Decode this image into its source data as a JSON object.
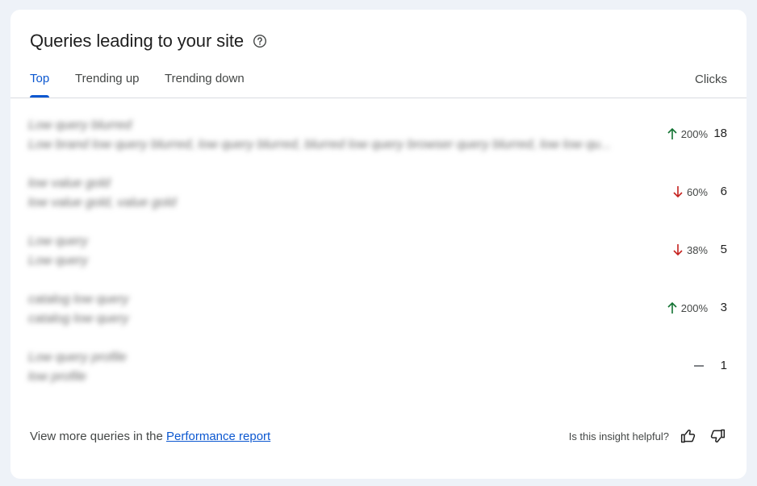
{
  "header": {
    "title": "Queries leading to your site",
    "help_icon": "help-circle-icon"
  },
  "tabs": [
    {
      "label": "Top",
      "active": true
    },
    {
      "label": "Trending up",
      "active": false
    },
    {
      "label": "Trending down",
      "active": false
    }
  ],
  "columns": {
    "clicks": "Clicks"
  },
  "rows": [
    {
      "query": "Low query blurred",
      "subtitle": "Low brand low query blurred, low query blurred, blurred low query browser query blurred, low low qu...",
      "trend": "up",
      "change": "200%",
      "clicks": "18"
    },
    {
      "query": "low value gold",
      "subtitle": "low value gold, value gold",
      "trend": "down",
      "change": "60%",
      "clicks": "6"
    },
    {
      "query": "Low query",
      "subtitle": "Low query",
      "trend": "down",
      "change": "38%",
      "clicks": "5"
    },
    {
      "query": "catalog low query",
      "subtitle": "catalog low query",
      "trend": "up",
      "change": "200%",
      "clicks": "3"
    },
    {
      "query": "Low query profile",
      "subtitle": "low profile",
      "trend": "flat",
      "change": "",
      "clicks": "1"
    }
  ],
  "colors": {
    "up": "#137333",
    "down": "#c5221f",
    "flat": "#5f6368",
    "accent": "#0b57d0"
  },
  "footer": {
    "more_prefix": "View more queries in the ",
    "more_link": "Performance report",
    "feedback_question": "Is this insight helpful?",
    "thumbs_up_icon": "thumb-up-icon",
    "thumbs_down_icon": "thumb-down-icon"
  }
}
